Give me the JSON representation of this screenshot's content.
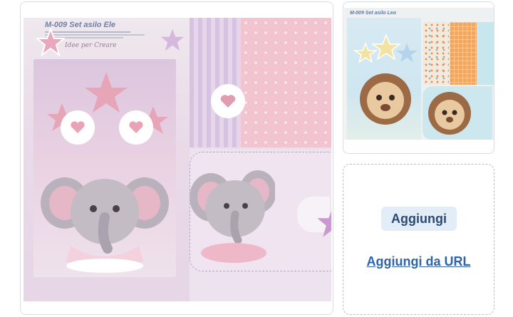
{
  "main_image": {
    "title": "M-009 Set asilo Ele",
    "brand": "Idee per Creare"
  },
  "thumbnail": {
    "title": "M-009 Set asilo Leo"
  },
  "actions": {
    "add_label": "Aggiungi",
    "add_url_label": "Aggiungi da URL"
  },
  "colors": {
    "button_bg": "#e3edf8",
    "button_text": "#2d4a73",
    "link": "#2f64a8",
    "card_border": "#d9dde3",
    "dashed_border": "#b8bec8"
  },
  "icons": [
    "star-icon",
    "heart-icon",
    "elephant-illustration",
    "lion-illustration"
  ]
}
